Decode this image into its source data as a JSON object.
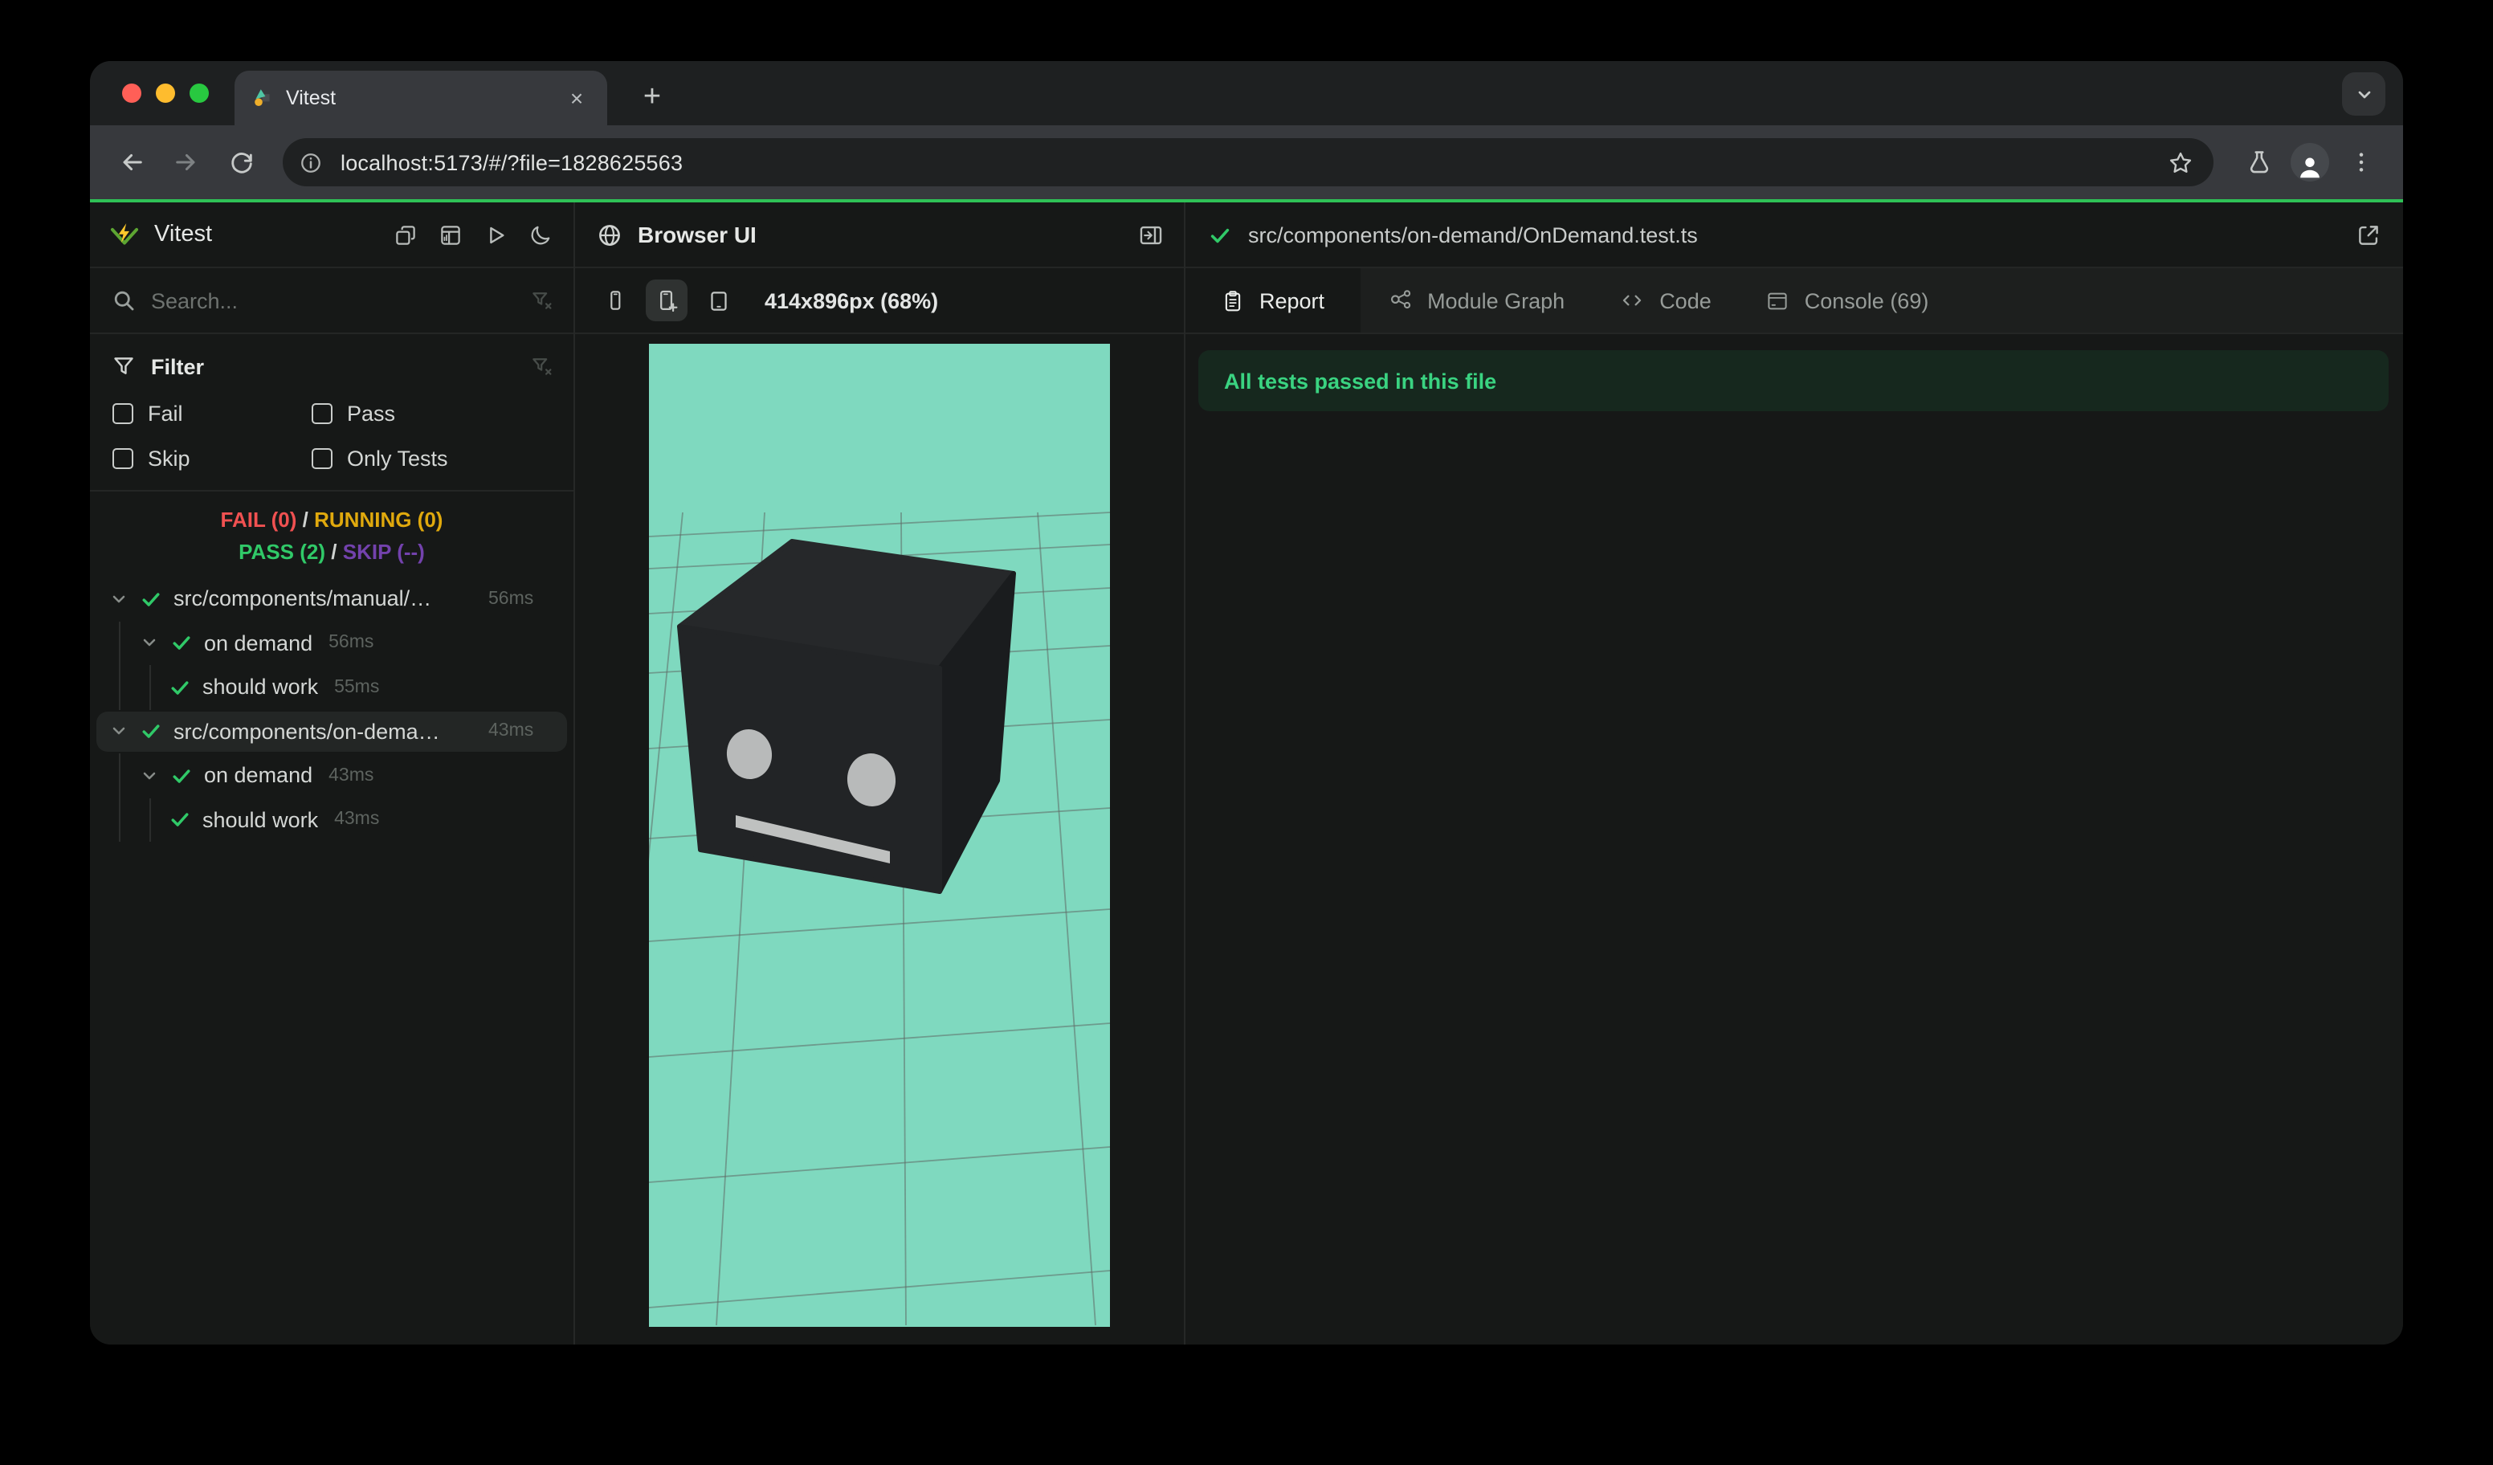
{
  "chrome": {
    "tab_title": "Vitest",
    "tab_close_glyph": "×",
    "new_tab_glyph": "+",
    "url": "localhost:5173/#/?file=1828625563",
    "traffic_lights": {
      "close": "#ff5f57",
      "minimize": "#febc2e",
      "zoom": "#28c840"
    }
  },
  "vitest": {
    "brand": "Vitest",
    "accent_green": "#2fc156",
    "search_placeholder": "Search...",
    "filter": {
      "title": "Filter",
      "options": [
        {
          "label": "Fail",
          "checked": false
        },
        {
          "label": "Pass",
          "checked": false
        },
        {
          "label": "Skip",
          "checked": false
        },
        {
          "label": "Only Tests",
          "checked": false
        }
      ]
    },
    "summary": {
      "fail": "FAIL (0)",
      "sep": "/",
      "running": "RUNNING (0)",
      "pass": "PASS (2)",
      "skip": "SKIP (--)",
      "colors": {
        "fail": "#f05151",
        "running": "#e0a90d",
        "pass": "#30c968",
        "skip": "#7342ad"
      }
    },
    "tree": [
      {
        "label": "src/components/manual/…",
        "duration": "56ms",
        "level": 0,
        "selected": false
      },
      {
        "label": "on demand",
        "duration": "56ms",
        "level": 1,
        "selected": false
      },
      {
        "label": "should work",
        "duration": "55ms",
        "level": 2,
        "selected": false
      },
      {
        "label": "src/components/on-dema…",
        "duration": "43ms",
        "level": 0,
        "selected": true
      },
      {
        "label": "on demand",
        "duration": "43ms",
        "level": 1,
        "selected": false
      },
      {
        "label": "should work",
        "duration": "43ms",
        "level": 2,
        "selected": false
      }
    ]
  },
  "browser_ui": {
    "title": "Browser UI",
    "viewport_label": "414x896px (68%)",
    "viewport_background": "#7fd9bf"
  },
  "report": {
    "file_path": "src/components/on-demand/OnDemand.test.ts",
    "tabs": [
      {
        "label": "Report",
        "active": true
      },
      {
        "label": "Module Graph",
        "active": false
      },
      {
        "label": "Code",
        "active": false
      },
      {
        "label": "Console (69)",
        "active": false
      }
    ],
    "banner": "All tests passed in this file",
    "banner_color": "#3ad381"
  }
}
